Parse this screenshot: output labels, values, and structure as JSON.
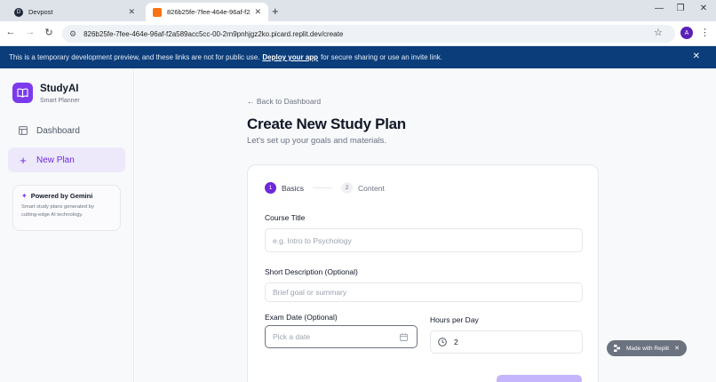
{
  "browser": {
    "tabs": [
      {
        "title": "Devpost",
        "active": false
      },
      {
        "title": "826b25fe-7fee-464e-96af-f2a589a",
        "active": true
      }
    ],
    "url": "826b25fe-7fee-464e-96af-f2a589acc5cc-00-2rn9pnhjgz2ko.picard.replit.dev/create",
    "profile_initial": "A"
  },
  "banner": {
    "prefix": "This is a temporary development preview, and these links are not for public use.",
    "link": "Deploy your app",
    "suffix": "for secure sharing or use an invite link."
  },
  "sidebar": {
    "brand_name": "StudyAI",
    "brand_sub": "Smart Planner",
    "items": [
      {
        "label": "Dashboard"
      },
      {
        "label": "New Plan"
      }
    ],
    "gemini_title": "Powered by Gemini",
    "gemini_desc": "Smart study plans generated by cutting-edge AI technology."
  },
  "main": {
    "back_link": "← Back to Dashboard",
    "title": "Create New Study Plan",
    "subtitle": "Let's set up your goals and materials.",
    "steps": [
      {
        "number": "1",
        "label": "Basics"
      },
      {
        "number": "2",
        "label": "Content"
      }
    ],
    "course_title_label": "Course Title",
    "course_title_placeholder": "e.g. Intro to Psychology",
    "description_label": "Short Description (Optional)",
    "description_placeholder": "Brief goal or summary",
    "exam_date_label": "Exam Date (Optional)",
    "exam_date_placeholder": "Pick a date",
    "hours_label": "Hours per Day",
    "hours_value": "2"
  },
  "badge": {
    "label": "Made with Replit"
  },
  "colors": {
    "accent": "#6d28d9",
    "banner": "#0b3d7a"
  }
}
